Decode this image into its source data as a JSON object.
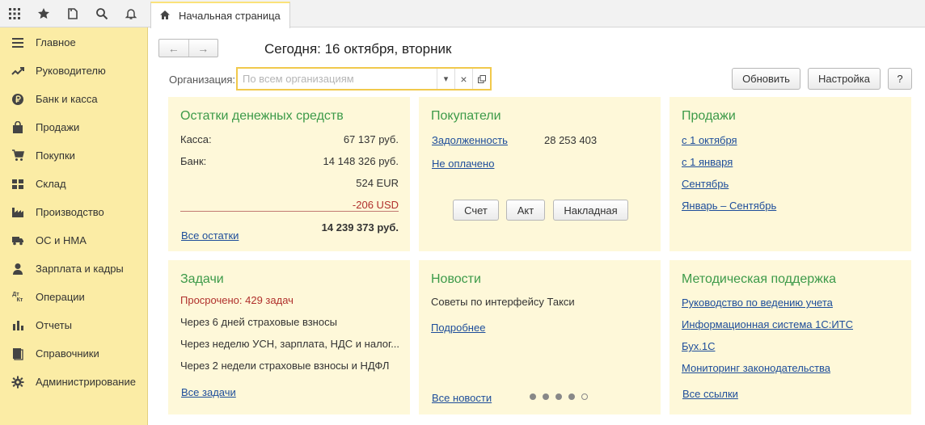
{
  "toolbar": {
    "icons": [
      "apps-grid-icon",
      "star-icon",
      "history-icon",
      "search-icon",
      "bell-icon"
    ]
  },
  "tab": {
    "label": "Начальная страница"
  },
  "sidebar": {
    "items": [
      {
        "label": "Главное",
        "icon": "menu-lines-icon"
      },
      {
        "label": "Руководителю",
        "icon": "trend-icon"
      },
      {
        "label": "Банк и касса",
        "icon": "ruble-coin-icon"
      },
      {
        "label": "Продажи",
        "icon": "shopping-bag-icon"
      },
      {
        "label": "Покупки",
        "icon": "cart-icon"
      },
      {
        "label": "Склад",
        "icon": "warehouse-grid-icon"
      },
      {
        "label": "Производство",
        "icon": "factory-icon"
      },
      {
        "label": "ОС и НМА",
        "icon": "truck-icon"
      },
      {
        "label": "Зарплата и кадры",
        "icon": "person-icon"
      },
      {
        "label": "Операции",
        "icon": "debit-credit-icon"
      },
      {
        "label": "Отчеты",
        "icon": "bar-chart-icon"
      },
      {
        "label": "Справочники",
        "icon": "books-icon"
      },
      {
        "label": "Администрирование",
        "icon": "gear-icon"
      }
    ],
    "operations_glyph_top": "Дт",
    "operations_glyph_bottom": "Кт"
  },
  "header": {
    "back": "←",
    "forward": "→",
    "today": "Сегодня: 16 октября, вторник",
    "org_label": "Организация:",
    "org_placeholder": "По всем организациям",
    "dropdown_glyph": "▾",
    "clear_glyph": "×",
    "refresh_label": "Обновить",
    "settings_label": "Настройка",
    "help_label": "?"
  },
  "cash": {
    "title": "Остатки денежных средств",
    "kassa_label": "Касса:",
    "kassa_value": "67 137 руб.",
    "bank_label": "Банк:",
    "bank_value": "14 148 326 руб.",
    "eur_value": "524 EUR",
    "usd_value": "-206 USD",
    "all_link": "Все остатки",
    "total": "14 239 373 руб."
  },
  "buyers": {
    "title": "Покупатели",
    "debt_link": "Задолженность",
    "debt_value": "28 253 403",
    "unpaid_link": "Не оплачено",
    "btn_invoice": "Счет",
    "btn_act": "Акт",
    "btn_waybill": "Накладная"
  },
  "sales": {
    "title": "Продажи",
    "links": [
      "с 1 октября",
      "с 1 января",
      "Сентябрь",
      "Январь – Сентябрь"
    ]
  },
  "tasks": {
    "title": "Задачи",
    "overdue": "Просрочено: 429 задач",
    "items": [
      "Через 6 дней страховые взносы",
      "Через неделю УСН, зарплата, НДС и налог...",
      "Через 2 недели страховые взносы и НДФЛ"
    ],
    "all_link": "Все задачи"
  },
  "news": {
    "title": "Новости",
    "headline": "Советы по интерфейсу Такси",
    "more_link": "Подробнее",
    "all_link": "Все новости"
  },
  "support": {
    "title": "Методическая поддержка",
    "links": [
      "Руководство по ведению учета",
      "Информационная система 1С:ИТС",
      "Бух.1С",
      "Мониторинг законодательства"
    ],
    "all_link": "Все ссылки"
  }
}
